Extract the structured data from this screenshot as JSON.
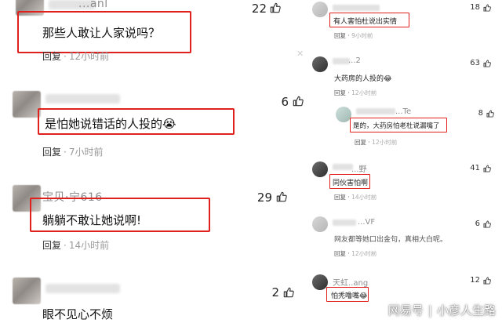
{
  "left": {
    "c1": {
      "name": "...anl",
      "text": "那些人敢让人家说吗？",
      "reply": "回复",
      "time": "12小时前",
      "likes": "22"
    },
    "c2": {
      "name": "",
      "text": "是怕她说错话的人投的",
      "emoji": "😭",
      "reply": "回复",
      "time": "7小时前",
      "likes": "6"
    },
    "c3": {
      "name": "宝贝·宁616",
      "text": "躺躺不敢让她说啊!",
      "reply": "回复",
      "time": "14小时前",
      "likes": "29"
    },
    "c4": {
      "name": "",
      "text": "眼不见心不烦",
      "reply": "",
      "time": "",
      "likes": "2"
    }
  },
  "right": {
    "r1": {
      "text": "有人害怕杜说出实情",
      "reply": "回复",
      "time": "9小时前",
      "likes": "18"
    },
    "r2": {
      "name": "...2",
      "text": "大药房的人投的",
      "emoji": "😂",
      "reply": "回复",
      "time": "12小时前",
      "likes": "63"
    },
    "r3": {
      "name": "...Te",
      "text": "是的，大药房怕老杜说漏嘴了",
      "reply": "回复",
      "time": "12小时前",
      "likes": "8"
    },
    "r4": {
      "name": "...野",
      "text": "同伙害怕啊",
      "reply": "回复",
      "time": "14小时前",
      "likes": "41"
    },
    "r5": {
      "name": "...VF",
      "text": "网友都等她口出金句，真相大白呢。",
      "reply": "回复",
      "time": "12小时前",
      "likes": "6"
    },
    "r6": {
      "name": "天虹..ang",
      "text": "怕秃噜嘴",
      "emoji": "😂",
      "likes": "12"
    }
  },
  "watermark": {
    "brand": "网易号",
    "sep": "|",
    "author": "小彦人生路"
  },
  "colors": {
    "highlight_red": "#e0201c",
    "muted_text": "#999999"
  }
}
